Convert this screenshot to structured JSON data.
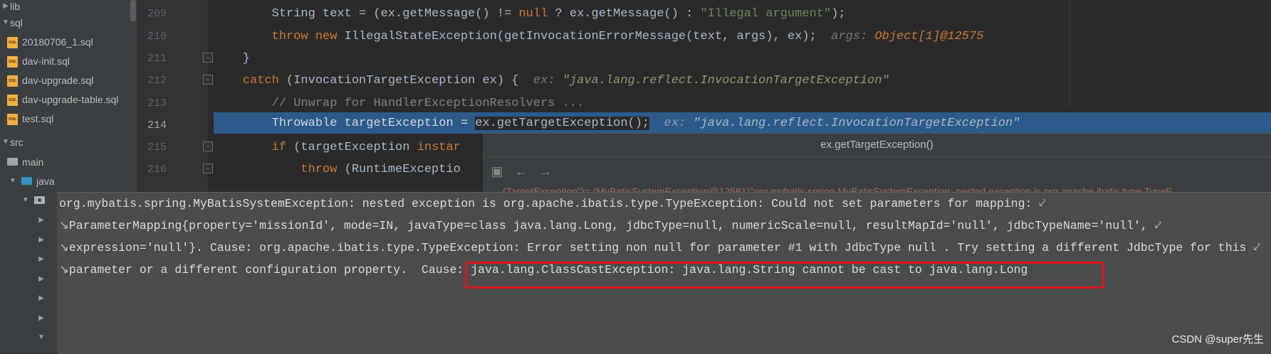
{
  "tree": {
    "items": [
      {
        "label": "lib",
        "icon": "folder-icon"
      },
      {
        "label": "sql",
        "icon": "folder-icon"
      },
      {
        "label": "20180706_1.sql",
        "icon": "sql-file-icon"
      },
      {
        "label": "dav-init.sql",
        "icon": "sql-file-icon"
      },
      {
        "label": "dav-upgrade.sql",
        "icon": "sql-file-icon"
      },
      {
        "label": "dav-upgrade-table.sql",
        "icon": "sql-file-icon"
      },
      {
        "label": "test.sql",
        "icon": "sql-file-icon"
      },
      {
        "label": "src",
        "icon": "folder-icon"
      },
      {
        "label": "main",
        "icon": "folder-icon"
      },
      {
        "label": "java",
        "icon": "folder-icon"
      }
    ]
  },
  "editor": {
    "lines": [
      {
        "num": "209"
      },
      {
        "num": "210"
      },
      {
        "num": "211"
      },
      {
        "num": "212"
      },
      {
        "num": "213"
      },
      {
        "num": "214"
      },
      {
        "num": "215"
      },
      {
        "num": "216"
      }
    ],
    "code": {
      "l209_a": "        String text = (ex.getMessage() != ",
      "l209_null": "null",
      "l209_b": " ? ex.getMessage() : ",
      "l209_str": "\"Illegal argument\"",
      "l209_c": ");",
      "l210_kw1": "throw",
      "l210_kw2": "new",
      "l210_a": " IllegalStateException(getInvocationErrorMessage(text, args), ex);",
      "l210_hint": "args: ",
      "l210_hintval": "Object[1]@12575",
      "l211": "    }",
      "l212_kw": "catch",
      "l212_a": " (InvocationTargetException ex) {",
      "l212_hint": "ex: ",
      "l212_hintval": "\"java.lang.reflect.InvocationTargetException\"",
      "l213": "// Unwrap for HandlerExceptionResolvers ...",
      "l214_a": "Throwable targetException = ",
      "l214_b": "ex.getTargetException();",
      "l214_hint": "ex: ",
      "l214_hintval": "\"java.lang.reflect.InvocationTargetException\"",
      "l215_kw": "if",
      "l215_a": " (targetException ",
      "l215_kw2": "instar",
      "l216_kw": "throw",
      "l216_a": " (RuntimeExceptio"
    }
  },
  "popup": {
    "title": "ex.getTargetException()",
    "node_text": "(TargetException\")= (MyBatisSystemException@12581)\"org.mybatis.spring.MyBatisSystemException: nested exception is org.apache.ibatis.type.TypeE"
  },
  "tooltip": {
    "lines": [
      "org.mybatis.spring.MyBatisSystemException: nested exception is org.apache.ibatis.type.TypeException: Could not set parameters for mapping: ",
      "ParameterMapping{property='missionId', mode=IN, javaType=class java.lang.Long, jdbcType=null, numericScale=null, resultMapId='null', jdbcTypeName='null', ",
      "expression='null'}. Cause: org.apache.ibatis.type.TypeException: Error setting non null for parameter #1 with JdbcType null . Try setting a different JdbcType for this ",
      "parameter or a different configuration property. "
    ],
    "cause": "Cause: java.lang.ClassCastException: java.lang.String cannot be cast to java.lang.Long",
    "wrap_mark": "⤦",
    "cont_mark": "↘"
  },
  "watermark": "CSDN @super先生"
}
